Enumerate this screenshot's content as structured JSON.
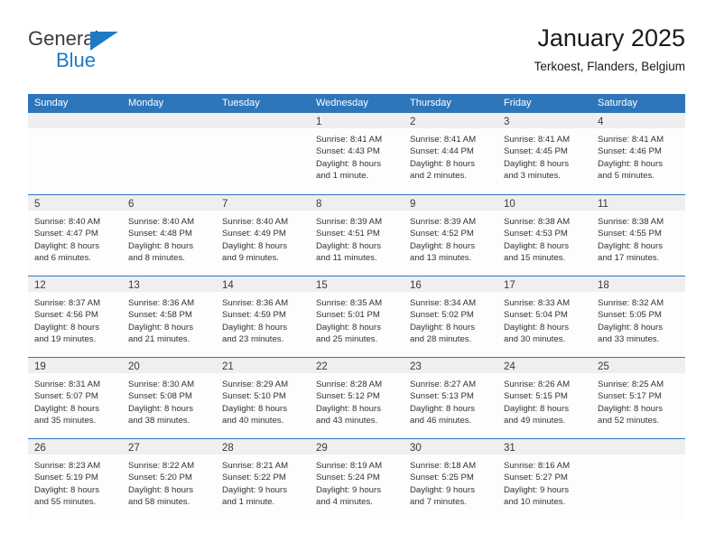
{
  "brand": {
    "name_primary": "General",
    "name_secondary": "Blue",
    "accent_color": "#1F7AC4"
  },
  "header": {
    "title": "January 2025",
    "location": "Terkoest, Flanders, Belgium"
  },
  "calendar": {
    "header_color": "#2E76BC",
    "weekdays": [
      "Sunday",
      "Monday",
      "Tuesday",
      "Wednesday",
      "Thursday",
      "Friday",
      "Saturday"
    ],
    "weeks": [
      [
        {
          "day": "",
          "empty": true
        },
        {
          "day": "",
          "empty": true
        },
        {
          "day": "",
          "empty": true
        },
        {
          "day": "1",
          "sunrise": "Sunrise: 8:41 AM",
          "sunset": "Sunset: 4:43 PM",
          "daylight_1": "Daylight: 8 hours",
          "daylight_2": "and 1 minute."
        },
        {
          "day": "2",
          "sunrise": "Sunrise: 8:41 AM",
          "sunset": "Sunset: 4:44 PM",
          "daylight_1": "Daylight: 8 hours",
          "daylight_2": "and 2 minutes."
        },
        {
          "day": "3",
          "sunrise": "Sunrise: 8:41 AM",
          "sunset": "Sunset: 4:45 PM",
          "daylight_1": "Daylight: 8 hours",
          "daylight_2": "and 3 minutes."
        },
        {
          "day": "4",
          "sunrise": "Sunrise: 8:41 AM",
          "sunset": "Sunset: 4:46 PM",
          "daylight_1": "Daylight: 8 hours",
          "daylight_2": "and 5 minutes."
        }
      ],
      [
        {
          "day": "5",
          "sunrise": "Sunrise: 8:40 AM",
          "sunset": "Sunset: 4:47 PM",
          "daylight_1": "Daylight: 8 hours",
          "daylight_2": "and 6 minutes."
        },
        {
          "day": "6",
          "sunrise": "Sunrise: 8:40 AM",
          "sunset": "Sunset: 4:48 PM",
          "daylight_1": "Daylight: 8 hours",
          "daylight_2": "and 8 minutes."
        },
        {
          "day": "7",
          "sunrise": "Sunrise: 8:40 AM",
          "sunset": "Sunset: 4:49 PM",
          "daylight_1": "Daylight: 8 hours",
          "daylight_2": "and 9 minutes."
        },
        {
          "day": "8",
          "sunrise": "Sunrise: 8:39 AM",
          "sunset": "Sunset: 4:51 PM",
          "daylight_1": "Daylight: 8 hours",
          "daylight_2": "and 11 minutes."
        },
        {
          "day": "9",
          "sunrise": "Sunrise: 8:39 AM",
          "sunset": "Sunset: 4:52 PM",
          "daylight_1": "Daylight: 8 hours",
          "daylight_2": "and 13 minutes."
        },
        {
          "day": "10",
          "sunrise": "Sunrise: 8:38 AM",
          "sunset": "Sunset: 4:53 PM",
          "daylight_1": "Daylight: 8 hours",
          "daylight_2": "and 15 minutes."
        },
        {
          "day": "11",
          "sunrise": "Sunrise: 8:38 AM",
          "sunset": "Sunset: 4:55 PM",
          "daylight_1": "Daylight: 8 hours",
          "daylight_2": "and 17 minutes."
        }
      ],
      [
        {
          "day": "12",
          "sunrise": "Sunrise: 8:37 AM",
          "sunset": "Sunset: 4:56 PM",
          "daylight_1": "Daylight: 8 hours",
          "daylight_2": "and 19 minutes."
        },
        {
          "day": "13",
          "sunrise": "Sunrise: 8:36 AM",
          "sunset": "Sunset: 4:58 PM",
          "daylight_1": "Daylight: 8 hours",
          "daylight_2": "and 21 minutes."
        },
        {
          "day": "14",
          "sunrise": "Sunrise: 8:36 AM",
          "sunset": "Sunset: 4:59 PM",
          "daylight_1": "Daylight: 8 hours",
          "daylight_2": "and 23 minutes."
        },
        {
          "day": "15",
          "sunrise": "Sunrise: 8:35 AM",
          "sunset": "Sunset: 5:01 PM",
          "daylight_1": "Daylight: 8 hours",
          "daylight_2": "and 25 minutes."
        },
        {
          "day": "16",
          "sunrise": "Sunrise: 8:34 AM",
          "sunset": "Sunset: 5:02 PM",
          "daylight_1": "Daylight: 8 hours",
          "daylight_2": "and 28 minutes."
        },
        {
          "day": "17",
          "sunrise": "Sunrise: 8:33 AM",
          "sunset": "Sunset: 5:04 PM",
          "daylight_1": "Daylight: 8 hours",
          "daylight_2": "and 30 minutes."
        },
        {
          "day": "18",
          "sunrise": "Sunrise: 8:32 AM",
          "sunset": "Sunset: 5:05 PM",
          "daylight_1": "Daylight: 8 hours",
          "daylight_2": "and 33 minutes."
        }
      ],
      [
        {
          "day": "19",
          "sunrise": "Sunrise: 8:31 AM",
          "sunset": "Sunset: 5:07 PM",
          "daylight_1": "Daylight: 8 hours",
          "daylight_2": "and 35 minutes."
        },
        {
          "day": "20",
          "sunrise": "Sunrise: 8:30 AM",
          "sunset": "Sunset: 5:08 PM",
          "daylight_1": "Daylight: 8 hours",
          "daylight_2": "and 38 minutes."
        },
        {
          "day": "21",
          "sunrise": "Sunrise: 8:29 AM",
          "sunset": "Sunset: 5:10 PM",
          "daylight_1": "Daylight: 8 hours",
          "daylight_2": "and 40 minutes."
        },
        {
          "day": "22",
          "sunrise": "Sunrise: 8:28 AM",
          "sunset": "Sunset: 5:12 PM",
          "daylight_1": "Daylight: 8 hours",
          "daylight_2": "and 43 minutes."
        },
        {
          "day": "23",
          "sunrise": "Sunrise: 8:27 AM",
          "sunset": "Sunset: 5:13 PM",
          "daylight_1": "Daylight: 8 hours",
          "daylight_2": "and 46 minutes."
        },
        {
          "day": "24",
          "sunrise": "Sunrise: 8:26 AM",
          "sunset": "Sunset: 5:15 PM",
          "daylight_1": "Daylight: 8 hours",
          "daylight_2": "and 49 minutes."
        },
        {
          "day": "25",
          "sunrise": "Sunrise: 8:25 AM",
          "sunset": "Sunset: 5:17 PM",
          "daylight_1": "Daylight: 8 hours",
          "daylight_2": "and 52 minutes."
        }
      ],
      [
        {
          "day": "26",
          "sunrise": "Sunrise: 8:23 AM",
          "sunset": "Sunset: 5:19 PM",
          "daylight_1": "Daylight: 8 hours",
          "daylight_2": "and 55 minutes."
        },
        {
          "day": "27",
          "sunrise": "Sunrise: 8:22 AM",
          "sunset": "Sunset: 5:20 PM",
          "daylight_1": "Daylight: 8 hours",
          "daylight_2": "and 58 minutes."
        },
        {
          "day": "28",
          "sunrise": "Sunrise: 8:21 AM",
          "sunset": "Sunset: 5:22 PM",
          "daylight_1": "Daylight: 9 hours",
          "daylight_2": "and 1 minute."
        },
        {
          "day": "29",
          "sunrise": "Sunrise: 8:19 AM",
          "sunset": "Sunset: 5:24 PM",
          "daylight_1": "Daylight: 9 hours",
          "daylight_2": "and 4 minutes."
        },
        {
          "day": "30",
          "sunrise": "Sunrise: 8:18 AM",
          "sunset": "Sunset: 5:25 PM",
          "daylight_1": "Daylight: 9 hours",
          "daylight_2": "and 7 minutes."
        },
        {
          "day": "31",
          "sunrise": "Sunrise: 8:16 AM",
          "sunset": "Sunset: 5:27 PM",
          "daylight_1": "Daylight: 9 hours",
          "daylight_2": "and 10 minutes."
        },
        {
          "day": "",
          "empty": true
        }
      ]
    ]
  }
}
